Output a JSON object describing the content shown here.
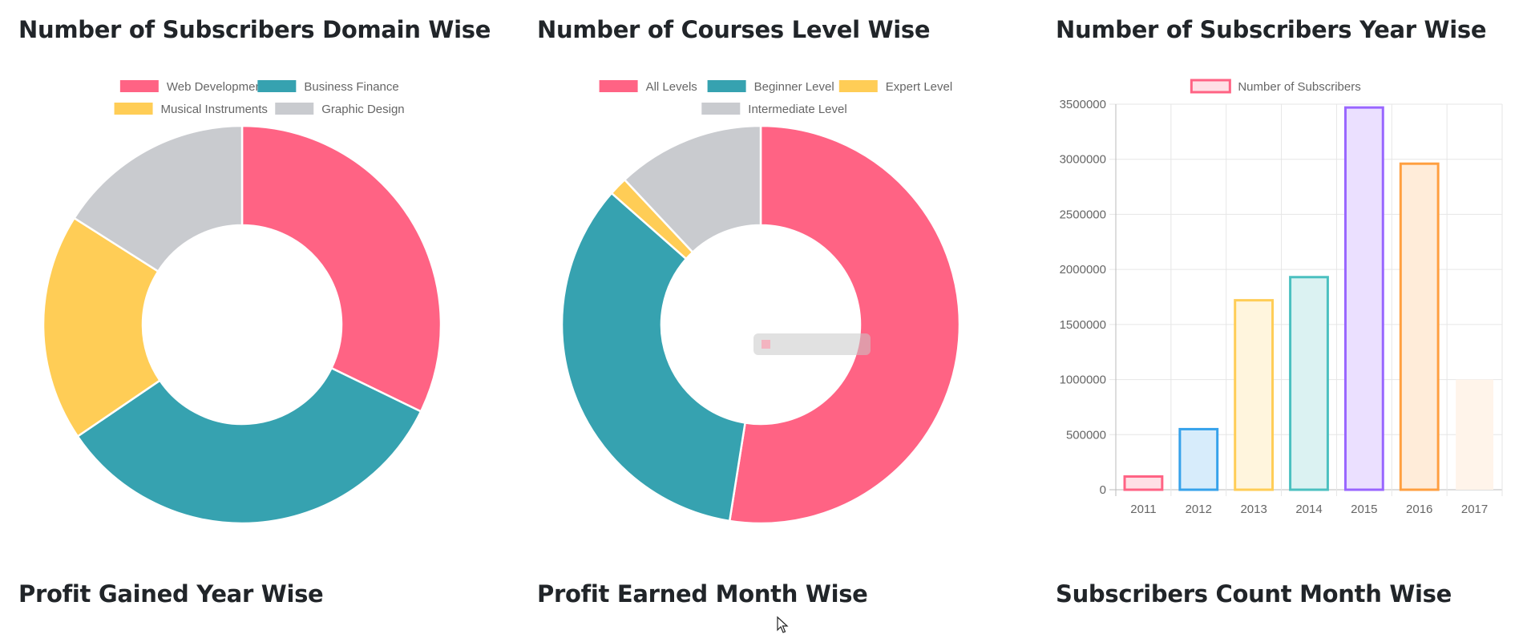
{
  "panels": {
    "domain": {
      "title": "Number of Subscribers Domain Wise"
    },
    "level": {
      "title": "Number of Courses Level Wise"
    },
    "year": {
      "title": "Number of Subscribers Year Wise"
    },
    "profit_year": {
      "title": "Profit Gained Year Wise"
    },
    "profit_month": {
      "title": "Profit Earned Month Wise"
    },
    "subs_month": {
      "title": "Subscribers Count Month Wise"
    }
  },
  "chart_data": [
    {
      "type": "doughnut",
      "title": "Number of Subscribers Domain Wise",
      "legend": "top",
      "labels": [
        "Web Development",
        "Business Finance",
        "Musical Instruments",
        "Graphic Design"
      ],
      "values": [
        32.2,
        33.3,
        18.5,
        16.0
      ],
      "colors": [
        "#ff6384",
        "#36a2b0",
        "#ffcd56",
        "#c9cbcf"
      ]
    },
    {
      "type": "doughnut",
      "title": "Number of Courses Level Wise",
      "legend": "top",
      "labels": [
        "All Levels",
        "Beginner Level",
        "Expert Level",
        "Intermediate Level"
      ],
      "values": [
        52.5,
        34.0,
        1.5,
        12.0
      ],
      "colors": [
        "#ff6384",
        "#36a2b0",
        "#ffcd56",
        "#c9cbcf"
      ]
    },
    {
      "type": "bar",
      "title": "Number of Subscribers Year Wise",
      "legend": "top",
      "grid": true,
      "categories": [
        "2011",
        "2012",
        "2013",
        "2014",
        "2015",
        "2016",
        "2017"
      ],
      "series": [
        {
          "name": "Number of Subscribers",
          "values": [
            120000,
            550000,
            1720000,
            1930000,
            3470000,
            2960000,
            1000000
          ]
        }
      ],
      "ylim": [
        0,
        3500000
      ],
      "yticks": [
        0,
        500000,
        1000000,
        1500000,
        2000000,
        2500000,
        3000000,
        3500000
      ],
      "bar_colors": [
        "#ff6384",
        "#36a2eb",
        "#ffcd56",
        "#4bc0c0",
        "#9966ff",
        "#ff9f40",
        "#ffe0c0"
      ],
      "bar_fills": [
        "#ffe0e6",
        "#d7ecfb",
        "#fff5dd",
        "#dbf2f2",
        "#ebe0ff",
        "#ffecd9",
        "#fff4ea"
      ]
    }
  ]
}
